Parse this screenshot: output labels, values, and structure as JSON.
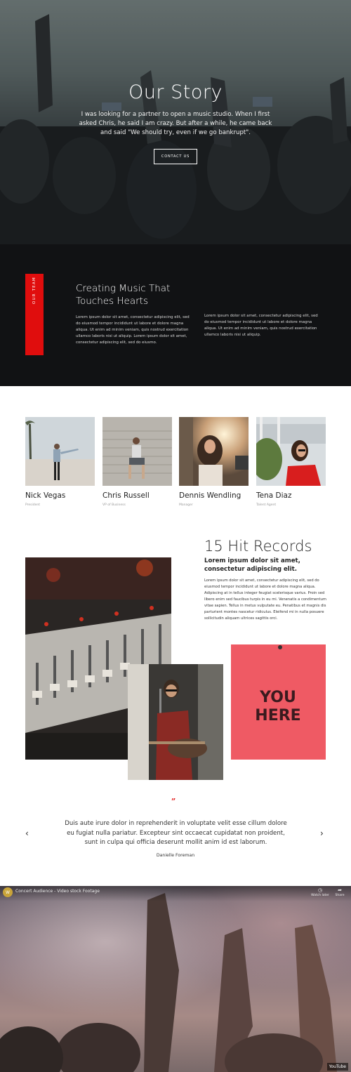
{
  "hero": {
    "title": "Our Story",
    "text": "I was looking for a partner to open a music studio. When I first asked Chris, he said I am crazy. But after a while, he came back and said \"We should try, even if we go bankrupt\".",
    "button_label": "CONTACT US"
  },
  "team_section": {
    "label": "OUR TEAM",
    "heading": "Creating Music That Touches Hearts",
    "paragraph_1": "Lorem ipsum dolor sit amet, consectetur adipiscing elit, sed do eiusmod tempor incididunt ut labore et dolore magna aliqua. Ut enim ad minim veniam, quis nostrud exercitation ullamco laboris nisi ut aliquip. Lorem ipsum dolor sit amet, consectetur adipiscing elit, sed do eiusmo.",
    "paragraph_2": "Lorem ipsum dolor sit amet, consectetur adipiscing elit, sed do eiusmod tempor incididunt ut labore et dolore magna aliqua. Ut enim ad minim veniam, quis nostrud exercitation ullamco laboris nisi ut aliquip.",
    "accent_color": "#e00d0d"
  },
  "members": [
    {
      "name": "Nick Vegas",
      "role": "President"
    },
    {
      "name": "Chris Russell",
      "role": "VP of Business"
    },
    {
      "name": "Dennis Wendling",
      "role": "Manager"
    },
    {
      "name": "Tena Diaz",
      "role": "Talent Agent"
    }
  ],
  "records": {
    "title": "15 Hit Records",
    "subtitle": "Lorem ipsum dolor sit amet, consectetur adipiscing elit.",
    "paragraph": "Lorem ipsum dolor sit amet, consectetur adipiscing elit, sed do eiusmod tempor incididunt ut labore et dolore magna aliqua. Adipiscing at in tellus integer feugiat scelerisque varius. Proin sed libero enim sed faucibus turpis in eu mi. Venenatis a condimentum vitae sapien. Tellus in metus vulputate eu. Penatibus et magnis dis parturient montes nascetur ridiculus. Eleifend mi in nulla posuere sollicitudin aliquam ultrices sagittis orci.",
    "poster_text": "YOU HERE"
  },
  "testimonial": {
    "quote_mark": "”",
    "text": "Duis aute irure dolor in reprehenderit in voluptate velit esse cillum dolore eu fugiat nulla pariatur. Excepteur sint occaecat cupidatat non proident, sunt in culpa qui officia deserunt mollit anim id est laborum.",
    "author": "Danielle Foreman",
    "prev_arrow": "‹",
    "next_arrow": "›"
  },
  "video": {
    "channel_initial": "W",
    "title": "Concert Audience - Video stock Footage",
    "watch_later_label": "Watch later",
    "share_label": "Share",
    "brand": "YouTube"
  }
}
